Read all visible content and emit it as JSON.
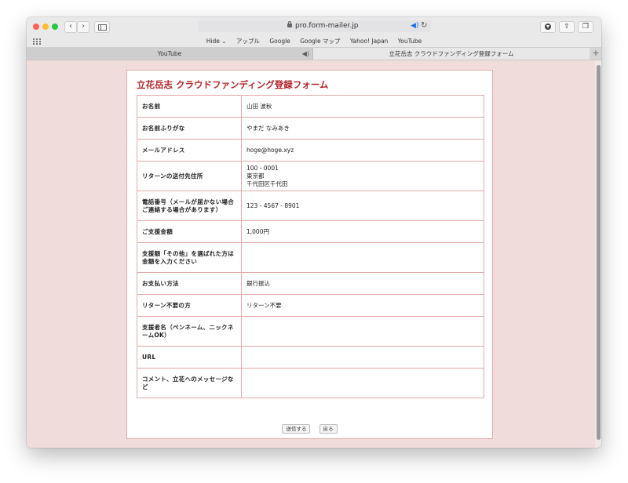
{
  "browser": {
    "url": "pro.form-mailer.jp",
    "bookmarks": [
      "Hide ⌄",
      "アップル",
      "Google",
      "Google マップ",
      "Yahoo! Japan",
      "YouTube"
    ],
    "tabs": [
      {
        "label": "YouTube",
        "active": false,
        "audio": true
      },
      {
        "label": "立花岳志 クラウドファンディング登録フォーム",
        "active": true
      }
    ]
  },
  "form": {
    "title": "立花岳志 クラウドファンディング登録フォーム",
    "rows": [
      {
        "label": "お名前",
        "value": [
          "山田 波秋"
        ]
      },
      {
        "label": "お名前ふりがな",
        "value": [
          "やまだ なみあき"
        ]
      },
      {
        "label": "メールアドレス",
        "value": [
          "hoge@hoge.xyz"
        ]
      },
      {
        "label": "リターンの送付先住所",
        "value": [
          "100 - 0001",
          "東京都",
          "千代田区千代田"
        ]
      },
      {
        "label": "電話番号（メールが届かない場合ご連絡する場合があります）",
        "value": [
          "123 - 4567 - 8901"
        ]
      },
      {
        "label": "ご支援金額",
        "value": [
          "1,000円"
        ]
      },
      {
        "label": "支援額「その他」を選ばれた方は金額を入力ください",
        "value": []
      },
      {
        "label": "お支払い方法",
        "value": [
          "銀行振込"
        ]
      },
      {
        "label": "リターン不要の方",
        "value": [
          "リターン不要"
        ]
      },
      {
        "label": "支援者名（ペンネーム、ニックネームOK）",
        "value": []
      },
      {
        "label": "URL",
        "value": []
      },
      {
        "label": "コメント、立花へのメッセージなど",
        "value": []
      }
    ],
    "submit_label": "送信する",
    "back_label": "戻る"
  },
  "colors": {
    "page_bg": "#f1dcdc",
    "title": "#b0262c",
    "border": "#e2a9a9"
  }
}
